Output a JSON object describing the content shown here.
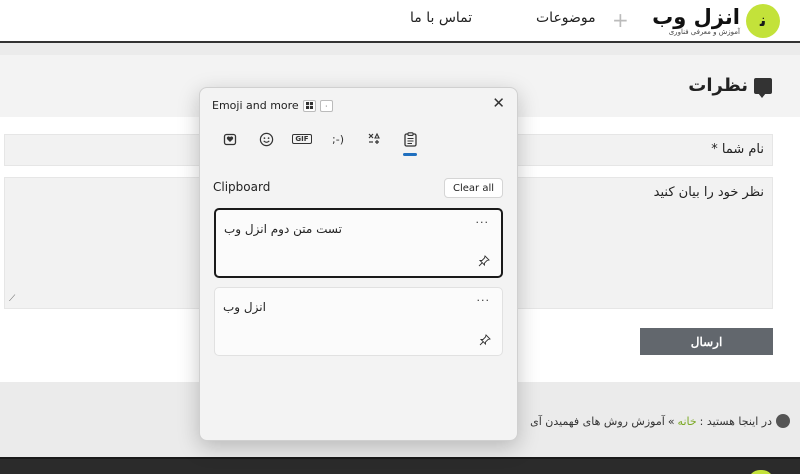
{
  "header": {
    "logo_mark": "ﻧ",
    "logo_name": "انزل وب",
    "logo_tagline": "آموزش و معرفی فناوری",
    "nav": [
      {
        "label": "موضوعات"
      },
      {
        "label": "تماس با ما"
      }
    ]
  },
  "comments": {
    "title": "نظرات",
    "name_label": "نام شما *",
    "message_label": "نظر خود را بیان کنید",
    "send_label": "ارسال"
  },
  "breadcrumb": {
    "prefix": "در اینجا هستید :",
    "home": "خانه",
    "separator": "»",
    "current": "آموزش روش های فهمیدن آی"
  },
  "panel": {
    "title": "Emoji and more",
    "key_hint": "۰",
    "close_icon": "close-icon",
    "tabs": [
      {
        "name": "kaomoji-heart-icon",
        "glyph": "♥"
      },
      {
        "name": "emoji-icon",
        "glyph": "☺"
      },
      {
        "name": "gif-icon",
        "glyph": "GIF"
      },
      {
        "name": "kaomoji-icon",
        "glyph": ";-)"
      },
      {
        "name": "symbols-icon",
        "glyph": "∆"
      },
      {
        "name": "clipboard-icon",
        "glyph": "📋"
      }
    ],
    "active_tab": "clipboard",
    "section_title": "Clipboard",
    "clear_label": "Clear all",
    "items": [
      {
        "text": "تست متن دوم انزل وب",
        "more": "···"
      },
      {
        "text": "انزل وب",
        "more": "···"
      }
    ]
  },
  "colors": {
    "brand": "#c3e23a",
    "accent": "#1f6fbf",
    "send_button": "#62676d",
    "home_link": "#7aa823"
  }
}
